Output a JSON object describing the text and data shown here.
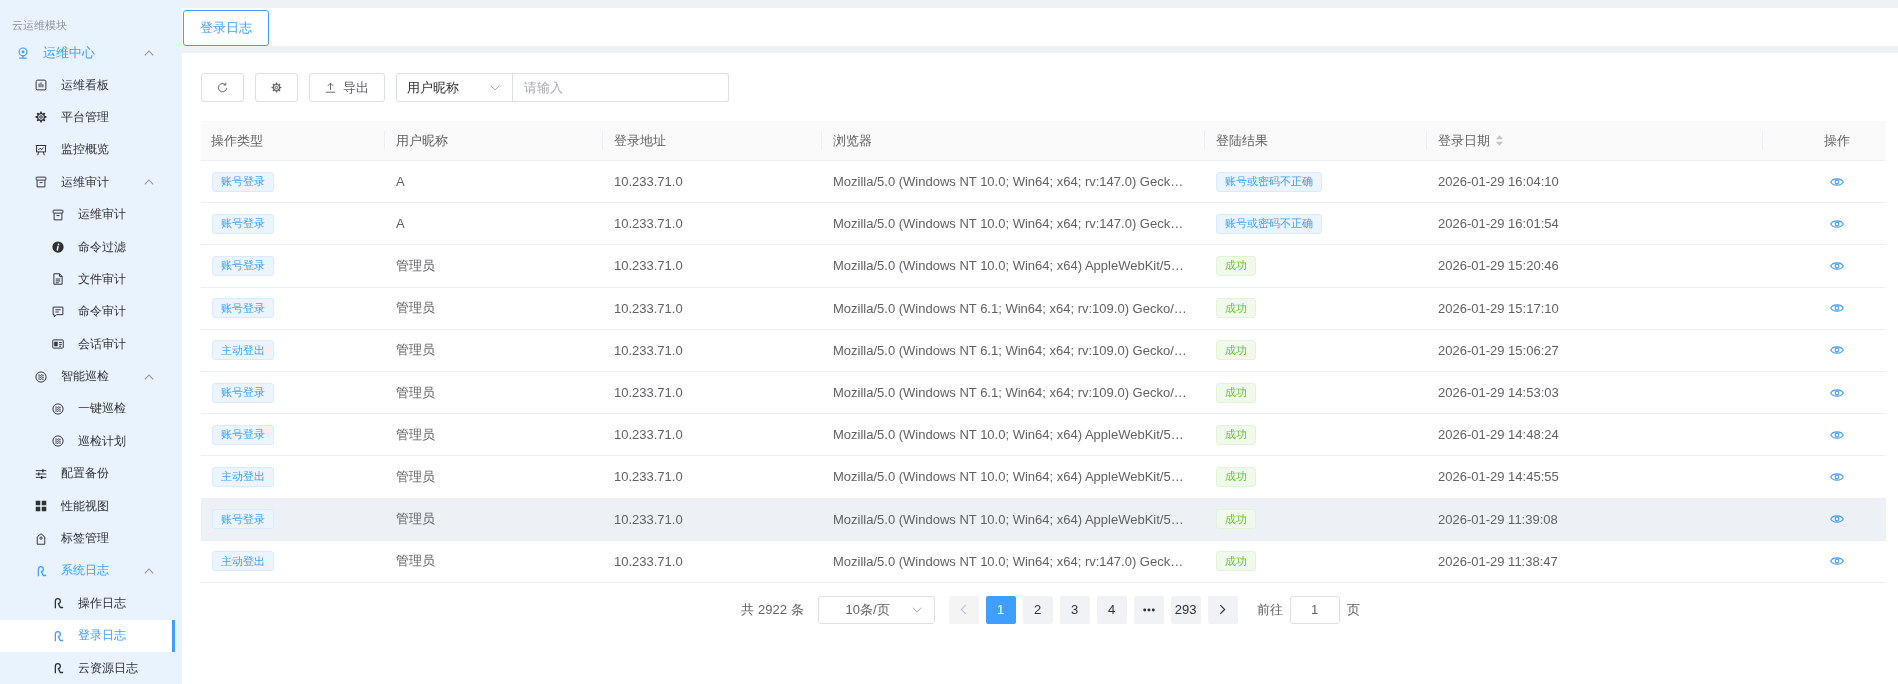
{
  "sidebar": {
    "section_title": "云运维模块",
    "items": [
      {
        "label": "运维中心",
        "selected": false,
        "expanded": true,
        "children": [
          {
            "label": "运维看板",
            "selected": false
          },
          {
            "label": "平台管理",
            "selected": false
          },
          {
            "label": "监控概览",
            "selected": false
          },
          {
            "label": "运维审计",
            "selected": false,
            "expanded": true,
            "children": [
              {
                "label": "运维审计",
                "selected": false
              },
              {
                "label": "命令过滤",
                "selected": false
              },
              {
                "label": "文件审计",
                "selected": false
              },
              {
                "label": "命令审计",
                "selected": false
              },
              {
                "label": "会话审计",
                "selected": false
              }
            ]
          },
          {
            "label": "智能巡检",
            "selected": false,
            "expanded": true,
            "children": [
              {
                "label": "一键巡检",
                "selected": false
              },
              {
                "label": "巡检计划",
                "selected": false
              }
            ]
          },
          {
            "label": "配置备份",
            "selected": false
          },
          {
            "label": "性能视图",
            "selected": false
          },
          {
            "label": "标签管理",
            "selected": false
          },
          {
            "label": "系统日志",
            "selected": false,
            "expanded": true,
            "children": [
              {
                "label": "操作日志",
                "selected": false
              },
              {
                "label": "登录日志",
                "selected": true
              },
              {
                "label": "云资源日志",
                "selected": false
              }
            ]
          }
        ]
      }
    ]
  },
  "tabs": [
    {
      "label": "登录日志",
      "selected": true
    }
  ],
  "toolbar": {
    "buttons": [
      {
        "kind": "refresh"
      },
      {
        "kind": "settings"
      },
      {
        "kind": "export",
        "label": "导出"
      }
    ],
    "search": {
      "field": "用户昵称",
      "placeholder": "请输入"
    }
  },
  "table": {
    "columns": [
      {
        "label": "操作类型",
        "sortable": false
      },
      {
        "label": "用户昵称",
        "sortable": false
      },
      {
        "label": "登录地址",
        "sortable": false
      },
      {
        "label": "浏览器",
        "sortable": false
      },
      {
        "label": "登陆结果",
        "sortable": false
      },
      {
        "label": "登录日期",
        "sortable": true
      },
      {
        "label": "操作",
        "sortable": false
      }
    ],
    "rows": [
      {
        "type": "账号登录",
        "user": "A",
        "address": "10.233.71.0",
        "browser": "Mozilla/5.0 (Windows NT 10.0; Win64; x64; rv:147.0) Geck…",
        "result": {
          "text": "账号或密码不正确",
          "kind": "primary"
        },
        "date": "2026-01-29 16:04:10",
        "highlighted": false
      },
      {
        "type": "账号登录",
        "user": "A",
        "address": "10.233.71.0",
        "browser": "Mozilla/5.0 (Windows NT 10.0; Win64; x64; rv:147.0) Geck…",
        "result": {
          "text": "账号或密码不正确",
          "kind": "primary"
        },
        "date": "2026-01-29 16:01:54",
        "highlighted": false
      },
      {
        "type": "账号登录",
        "user": "管理员",
        "address": "10.233.71.0",
        "browser": "Mozilla/5.0 (Windows NT 10.0; Win64; x64) AppleWebKit/5…",
        "result": {
          "text": "成功",
          "kind": "success"
        },
        "date": "2026-01-29 15:20:46",
        "highlighted": false
      },
      {
        "type": "账号登录",
        "user": "管理员",
        "address": "10.233.71.0",
        "browser": "Mozilla/5.0 (Windows NT 6.1; Win64; x64; rv:109.0) Gecko/…",
        "result": {
          "text": "成功",
          "kind": "success"
        },
        "date": "2026-01-29 15:17:10",
        "highlighted": false
      },
      {
        "type": "主动登出",
        "user": "管理员",
        "address": "10.233.71.0",
        "browser": "Mozilla/5.0 (Windows NT 6.1; Win64; x64; rv:109.0) Gecko/…",
        "result": {
          "text": "成功",
          "kind": "success"
        },
        "date": "2026-01-29 15:06:27",
        "highlighted": false
      },
      {
        "type": "账号登录",
        "user": "管理员",
        "address": "10.233.71.0",
        "browser": "Mozilla/5.0 (Windows NT 6.1; Win64; x64; rv:109.0) Gecko/…",
        "result": {
          "text": "成功",
          "kind": "success"
        },
        "date": "2026-01-29 14:53:03",
        "highlighted": false
      },
      {
        "type": "账号登录",
        "user": "管理员",
        "address": "10.233.71.0",
        "browser": "Mozilla/5.0 (Windows NT 10.0; Win64; x64) AppleWebKit/5…",
        "result": {
          "text": "成功",
          "kind": "success"
        },
        "date": "2026-01-29 14:48:24",
        "highlighted": false
      },
      {
        "type": "主动登出",
        "user": "管理员",
        "address": "10.233.71.0",
        "browser": "Mozilla/5.0 (Windows NT 10.0; Win64; x64) AppleWebKit/5…",
        "result": {
          "text": "成功",
          "kind": "success"
        },
        "date": "2026-01-29 14:45:55",
        "highlighted": false
      },
      {
        "type": "账号登录",
        "user": "管理员",
        "address": "10.233.71.0",
        "browser": "Mozilla/5.0 (Windows NT 10.0; Win64; x64) AppleWebKit/5…",
        "result": {
          "text": "成功",
          "kind": "success"
        },
        "date": "2026-01-29 11:39:08",
        "highlighted": true
      },
      {
        "type": "主动登出",
        "user": "管理员",
        "address": "10.233.71.0",
        "browser": "Mozilla/5.0 (Windows NT 10.0; Win64; x64; rv:147.0) Geck…",
        "result": {
          "text": "成功",
          "kind": "success"
        },
        "date": "2026-01-29 11:38:47",
        "highlighted": false
      }
    ]
  },
  "pagination": {
    "total": "共 2922 条",
    "page_size": "10条/页",
    "prev_disabled": true,
    "next_disabled": false,
    "pages": [
      {
        "kind": "page",
        "label": "1",
        "selected": true
      },
      {
        "kind": "page",
        "label": "2",
        "selected": false
      },
      {
        "kind": "page",
        "label": "3",
        "selected": false
      },
      {
        "kind": "page",
        "label": "4",
        "selected": false
      },
      {
        "kind": "more",
        "selected": false
      },
      {
        "kind": "page",
        "label": "293",
        "selected": false
      }
    ],
    "jump_label": "前往",
    "jump_value": "1",
    "jump_suffix": "页"
  }
}
